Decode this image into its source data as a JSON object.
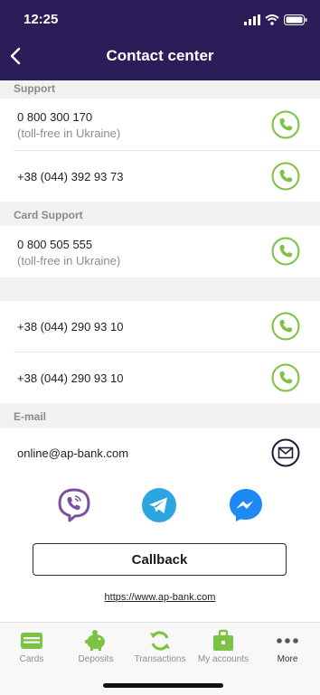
{
  "status_bar": {
    "time": "12:25"
  },
  "header": {
    "title": "Contact center"
  },
  "sections": {
    "support": "Support",
    "card_support": "Card Support",
    "email": "E-mail"
  },
  "rows": [
    {
      "number": "0 800 300 170",
      "note": "(toll-free in Ukraine)"
    },
    {
      "number": "+38 (044) 392 93 73"
    },
    {
      "number": "0 800 505 555",
      "note": "(toll-free in Ukraine)"
    },
    {
      "number": "+38 (044) 290 93 10"
    },
    {
      "number": "+38 (044) 290 93 10"
    }
  ],
  "email": {
    "address": "online@ap-bank.com"
  },
  "social": [
    "viber-icon",
    "telegram-icon",
    "messenger-icon"
  ],
  "callback": {
    "label": "Callback"
  },
  "website": {
    "url": "https://www.ap-bank.com"
  },
  "tabs": [
    {
      "label": "Cards",
      "icon": "card-icon"
    },
    {
      "label": "Deposits",
      "icon": "piggy-bank-icon"
    },
    {
      "label": "Transactions",
      "icon": "refresh-icon"
    },
    {
      "label": "My accounts",
      "icon": "briefcase-icon"
    },
    {
      "label": "More",
      "icon": "more-dots-icon",
      "active": true
    }
  ],
  "colors": {
    "header_bg": "#2b1d57",
    "accent_green": "#7cc243",
    "viber": "#7b519d",
    "telegram": "#2ca5e0",
    "messenger": "#1e88f5",
    "section_bg": "#f1f1f1"
  }
}
